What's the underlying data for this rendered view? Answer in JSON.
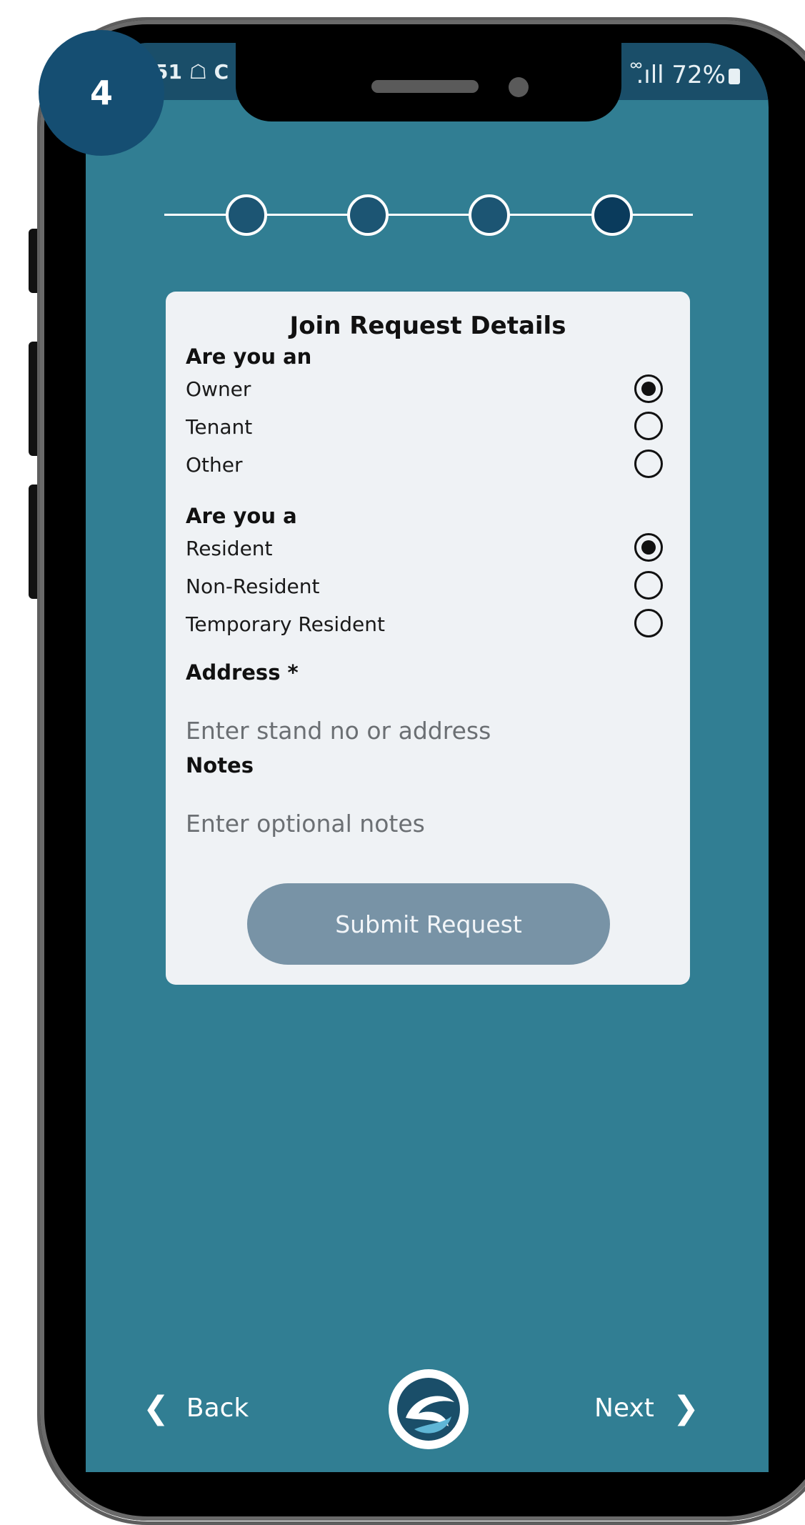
{
  "step_badge": "4",
  "status": {
    "left_text": "51 ☖ C",
    "right_text": "᪲.ıll 72%"
  },
  "stepper": {
    "total": 4,
    "active": 4
  },
  "form": {
    "title": "Join Request Details",
    "q1": {
      "label": "Are you an",
      "options": [
        "Owner",
        "Tenant",
        "Other"
      ],
      "selected": "Owner"
    },
    "q2": {
      "label": "Are you a",
      "options": [
        "Resident",
        "Non-Resident",
        "Temporary Resident"
      ],
      "selected": "Resident"
    },
    "address": {
      "label": "Address *",
      "placeholder": "Enter stand no or address",
      "value": ""
    },
    "notes": {
      "label": "Notes",
      "placeholder": "Enter optional notes",
      "value": ""
    },
    "submit_label": "Submit Request"
  },
  "nav": {
    "back_label": "Back",
    "next_label": "Next"
  },
  "colors": {
    "screen_bg": "#317e93",
    "badge_bg": "#154e72",
    "button_bg": "#7893a6"
  }
}
